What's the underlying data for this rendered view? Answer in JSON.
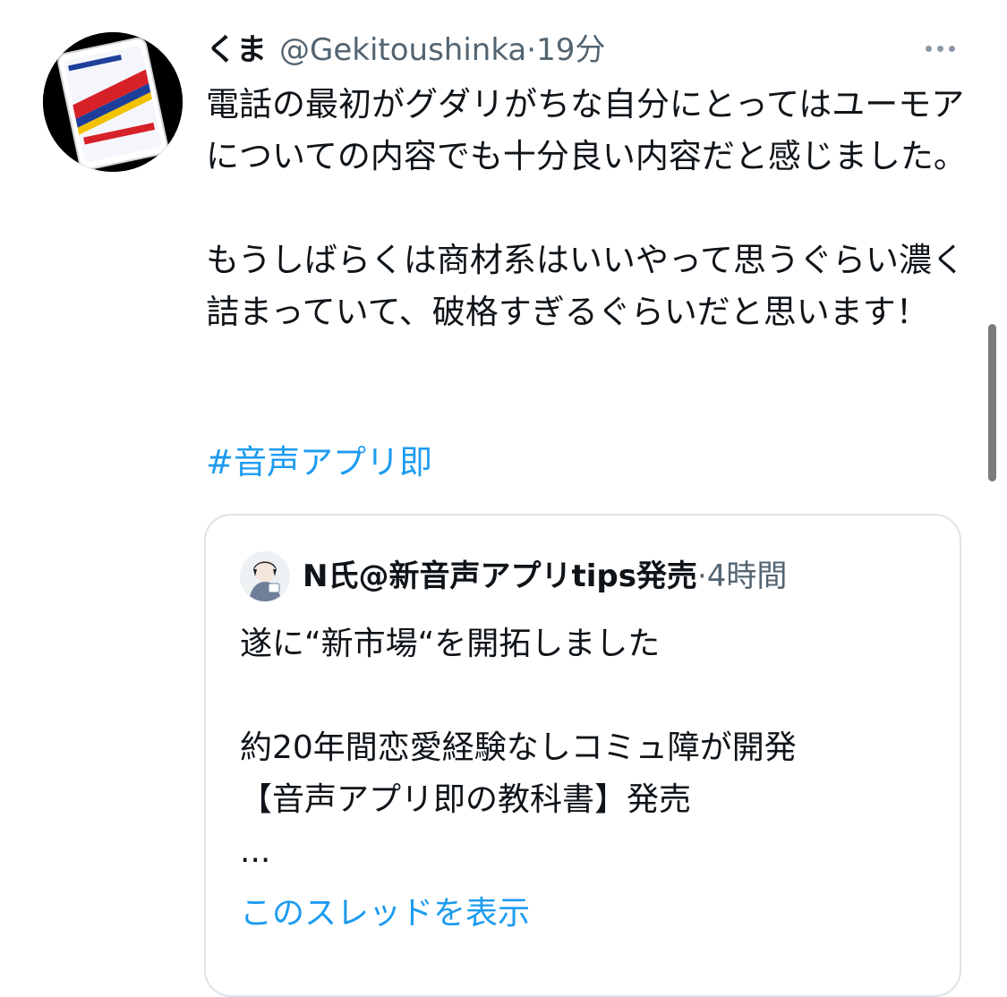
{
  "tweet": {
    "name": "くま",
    "handle": "@Gekitoushinka",
    "separator": "·",
    "time": "19分",
    "text": "電話の最初がグダリがちな自分にとってはユーモアについての内容でも十分良い内容だと感じました。\n\nもうしばらくは商材系はいいやって思うぐらい濃く詰まっていて、破格すぎるぐらいだと思います！",
    "hashtag": "#音声アプリ即",
    "avatar_icon": "frisk-mint-logo-avatar"
  },
  "quote": {
    "name": "N氏@新音声アプリtips発売",
    "separator": "·",
    "time": "4時間",
    "text": "遂に“新市場“を開拓しました\n\n約20年間恋愛経験なしコミュ障が開発\n【音声アプリ即の教科書】発売\n...",
    "link": "このスレッドを表示",
    "avatar_icon": "illustrated-person-avatar"
  },
  "colors": {
    "text": "#0f1419",
    "secondary": "#536471",
    "accent": "#1d9bf0",
    "border": "#dfe3e8"
  },
  "icons": {
    "more": "more-horizontal-icon"
  }
}
